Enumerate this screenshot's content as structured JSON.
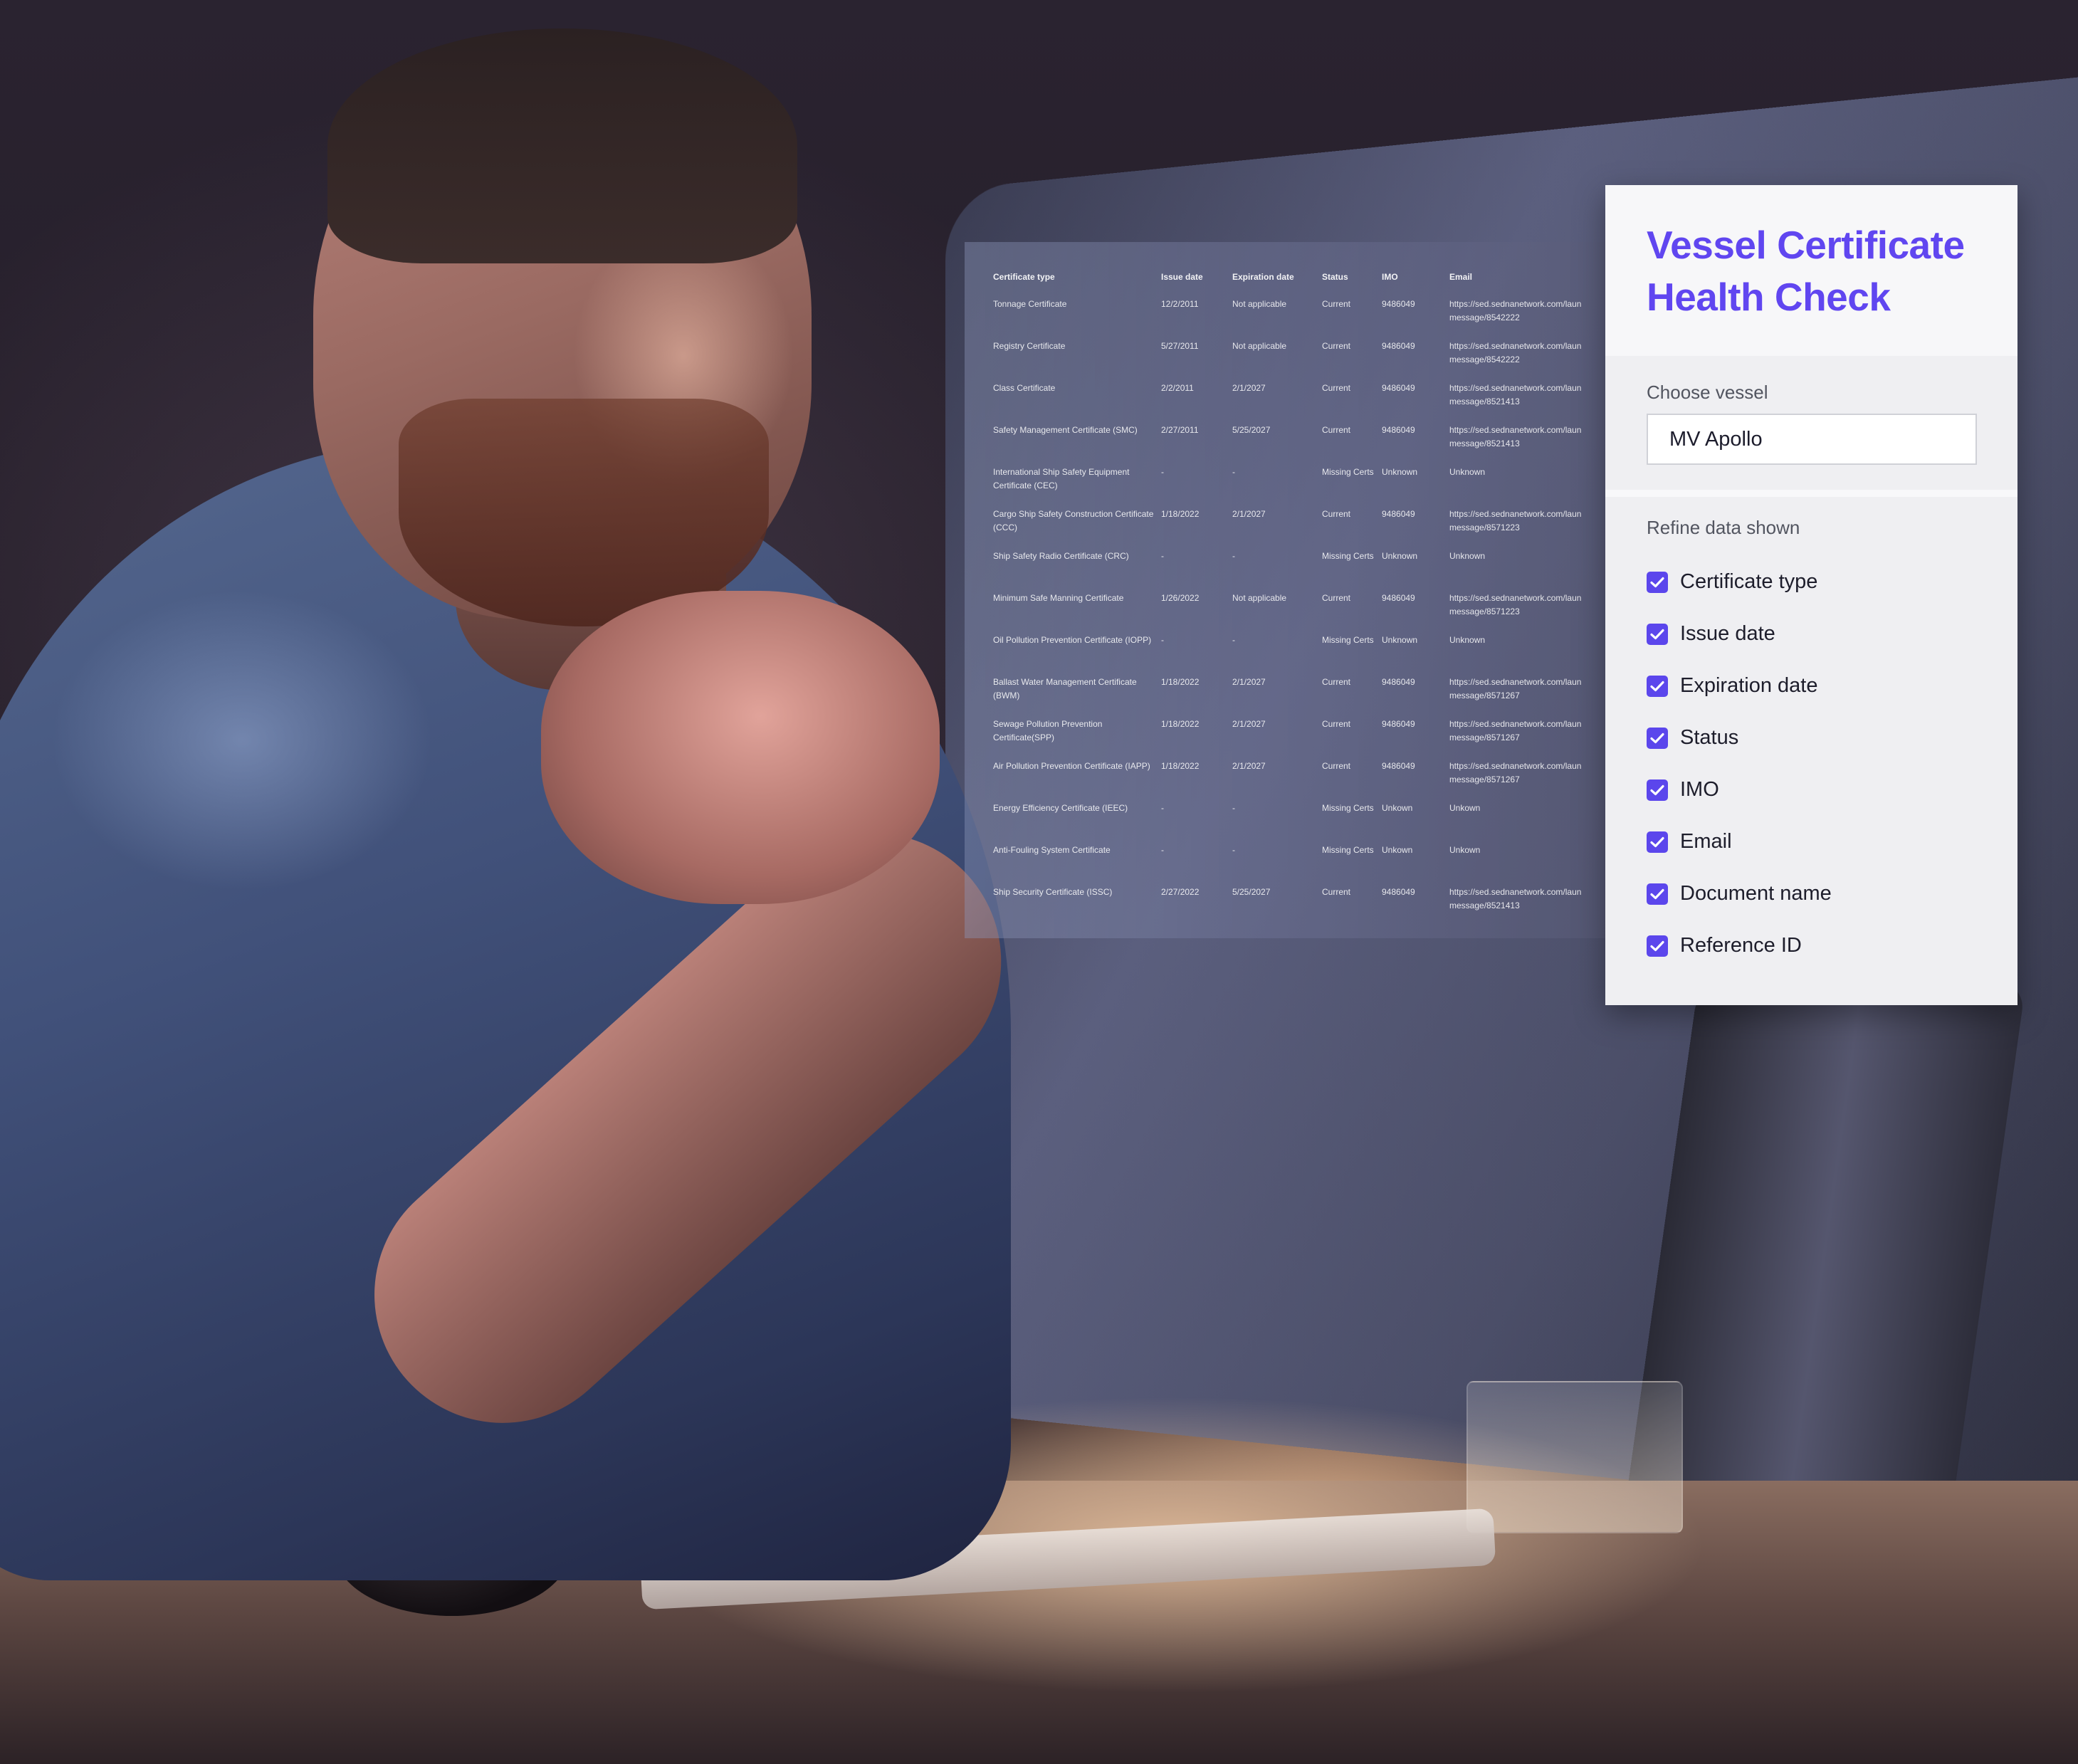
{
  "panel": {
    "title": "Vessel Certificate Health Check",
    "choose_vessel_label": "Choose vessel",
    "vessel_value": "MV Apollo",
    "refine_label": "Refine data shown",
    "accent_color": "#5b46ec",
    "options": [
      {
        "label": "Certificate type",
        "checked": true
      },
      {
        "label": "Issue date",
        "checked": true
      },
      {
        "label": "Expiration date",
        "checked": true
      },
      {
        "label": "Status",
        "checked": true
      },
      {
        "label": "IMO",
        "checked": true
      },
      {
        "label": "Email",
        "checked": true
      },
      {
        "label": "Document name",
        "checked": true
      },
      {
        "label": "Reference ID",
        "checked": true
      }
    ]
  },
  "table": {
    "headers": [
      "Certificate type",
      "Issue date",
      "Expiration date",
      "Status",
      "IMO",
      "Email"
    ],
    "rows": [
      [
        "Tonnage Certificate",
        "12/2/2011",
        "Not applicable",
        "Current",
        "9486049",
        "https://sed.sednanetwork.com/laun\nmessage/8542222"
      ],
      [
        "Registry Certificate",
        "5/27/2011",
        "Not applicable",
        "Current",
        "9486049",
        "https://sed.sednanetwork.com/laun\nmessage/8542222"
      ],
      [
        "Class Certificate",
        "2/2/2011",
        "2/1/2027",
        "Current",
        "9486049",
        "https://sed.sednanetwork.com/laun\nmessage/8521413"
      ],
      [
        "Safety Management Certificate (SMC)",
        "2/27/2011",
        "5/25/2027",
        "Current",
        "9486049",
        "https://sed.sednanetwork.com/laun\nmessage/8521413"
      ],
      [
        "International Ship Safety Equipment Certificate (CEC)",
        "-",
        "-",
        "Missing Certs",
        "Unknown",
        "Unknown"
      ],
      [
        "Cargo Ship Safety Construction Certificate (CCC)",
        "1/18/2022",
        "2/1/2027",
        "Current",
        "9486049",
        "https://sed.sednanetwork.com/laun\nmessage/8571223"
      ],
      [
        "Ship Safety Radio Certificate (CRC)",
        "-",
        "-",
        "Missing Certs",
        "Unknown",
        "Unknown"
      ],
      [
        "Minimum Safe Manning Certificate",
        "1/26/2022",
        "Not applicable",
        "Current",
        "9486049",
        "https://sed.sednanetwork.com/laun\nmessage/8571223"
      ],
      [
        "Oil Pollution Prevention Certificate (IOPP)",
        "-",
        "-",
        "Missing Certs",
        "Unknown",
        "Unknown"
      ],
      [
        "Ballast Water Management Certificate (BWM)",
        "1/18/2022",
        "2/1/2027",
        "Current",
        "9486049",
        "https://sed.sednanetwork.com/laun\nmessage/8571267"
      ],
      [
        "Sewage Pollution Prevention Certificate(SPP)",
        "1/18/2022",
        "2/1/2027",
        "Current",
        "9486049",
        "https://sed.sednanetwork.com/laun\nmessage/8571267"
      ],
      [
        "Air Pollution Prevention Certificate (IAPP)",
        "1/18/2022",
        "2/1/2027",
        "Current",
        "9486049",
        "https://sed.sednanetwork.com/laun\nmessage/8571267"
      ],
      [
        "Energy Efficiency Certificate (IEEC)",
        "-",
        "-",
        "Missing Certs",
        "Unkown",
        "Unkown"
      ],
      [
        "Anti-Fouling System Certificate",
        "-",
        "-",
        "Missing Certs",
        "Unkown",
        "Unkown"
      ],
      [
        "Ship Security Certificate (ISSC)",
        "2/27/2022",
        "5/25/2027",
        "Current",
        "9486049",
        "https://sed.sednanetwork.com/laun\nmessage/8521413"
      ]
    ]
  }
}
